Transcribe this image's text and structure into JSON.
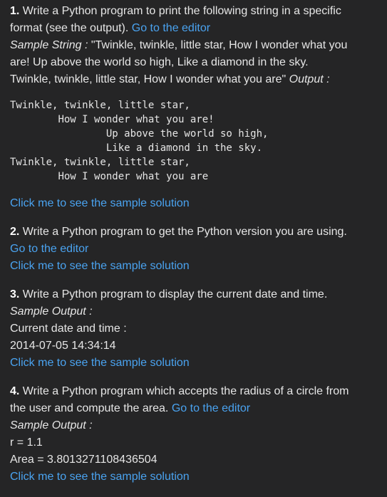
{
  "exercises": [
    {
      "number": "1.",
      "text_line1": "Write a Python program to print the following string in a specific",
      "text_line2": "format (see the output).",
      "editor_link": "Go to the editor",
      "sample_string_label": "Sample String :",
      "sample_string_line1": " \"Twinkle, twinkle, little star, How I wonder what you",
      "sample_string_line2": "are! Up above the world so high, Like a diamond in the sky.",
      "sample_string_line3": "Twinkle, twinkle, little star, How I wonder what you are\"",
      "output_label": "Output :",
      "output_code": "Twinkle, twinkle, little star,\n\tHow I wonder what you are!\n\t\tUp above the world so high,\n\t\tLike a diamond in the sky.\nTwinkle, twinkle, little star,\n\tHow I wonder what you are",
      "solution_link": "Click me to see the sample solution"
    },
    {
      "number": "2.",
      "text": "Write a Python program to get the Python version you are using.",
      "editor_link": "Go to the editor",
      "solution_link": "Click me to see the sample solution"
    },
    {
      "number": "3.",
      "text": "Write a Python program to display the current date and time.",
      "sample_output_label": "Sample Output :",
      "output_line1": "Current date and time :",
      "output_line2": "2014-07-05 14:34:14",
      "solution_link": "Click me to see the sample solution"
    },
    {
      "number": "4.",
      "text_line1": "Write a Python program which accepts the radius of a circle from",
      "text_line2": "the user and compute the area.",
      "editor_link": "Go to the editor",
      "sample_output_label": "Sample Output :",
      "output_line1": "r = 1.1",
      "output_line2": "Area = 3.8013271108436504",
      "solution_link": "Click me to see the sample solution"
    }
  ],
  "colors": {
    "background": "#252526",
    "text": "#e6e6e6",
    "link": "#4aa3f0"
  }
}
